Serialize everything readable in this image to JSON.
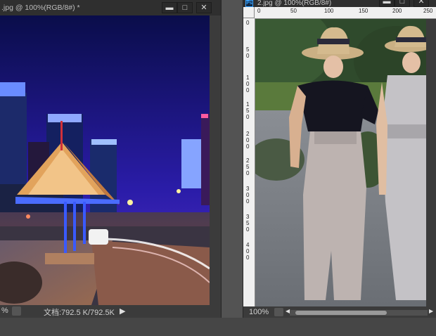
{
  "window1": {
    "title": ".jpg @ 100%(RGB/8#) *",
    "zoom": "%",
    "doc_info": "文档:792.5 K/792.5K",
    "buttons": {
      "minimize": "▬",
      "restore": "□",
      "close": "✕"
    }
  },
  "window2": {
    "title": "2.jpg @ 100%(RGB/8#)",
    "app_badge": "Ps",
    "zoom": "100%",
    "buttons": {
      "minimize": "▬",
      "restore": "□",
      "close": "✕"
    },
    "ruler_h": [
      "0",
      "50",
      "100",
      "150",
      "200",
      "250"
    ],
    "ruler_v": [
      "0",
      "5\n0",
      "1\n0\n0",
      "1\n5\n0",
      "2\n0\n0",
      "2\n5\n0",
      "3\n0\n0",
      "3\n5\n0",
      "4\n0\n0"
    ]
  },
  "colors": {
    "workspace": "#535353",
    "panel": "#3b3b3b",
    "ruler": "#f0f0f0"
  }
}
